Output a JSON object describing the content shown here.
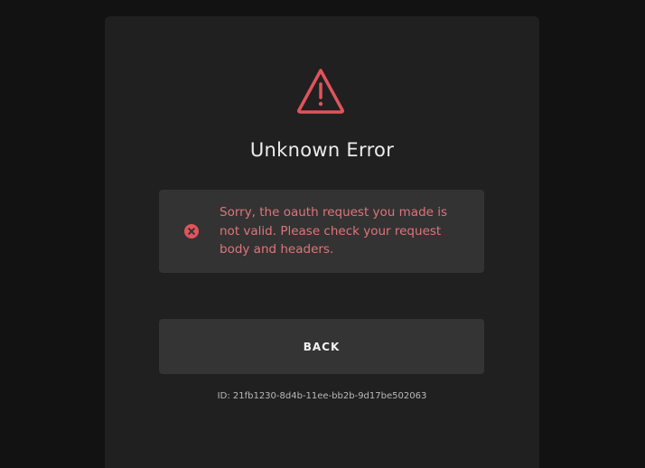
{
  "dialog": {
    "icon": "warning-triangle-icon",
    "title": "Unknown Error",
    "error": {
      "icon": "error-x-circle-icon",
      "message": "Sorry, the oauth request you made is not valid. Please check your request body and headers."
    },
    "back_button_label": "BACK",
    "request_id": "ID: 21fb1230-8d4b-11ee-bb2b-9d17be502063"
  },
  "colors": {
    "background": "#121212",
    "panel": "#202020",
    "error_box": "#333333",
    "error_accent": "#e0545c",
    "error_text": "#e0747a",
    "button": "#343434"
  }
}
